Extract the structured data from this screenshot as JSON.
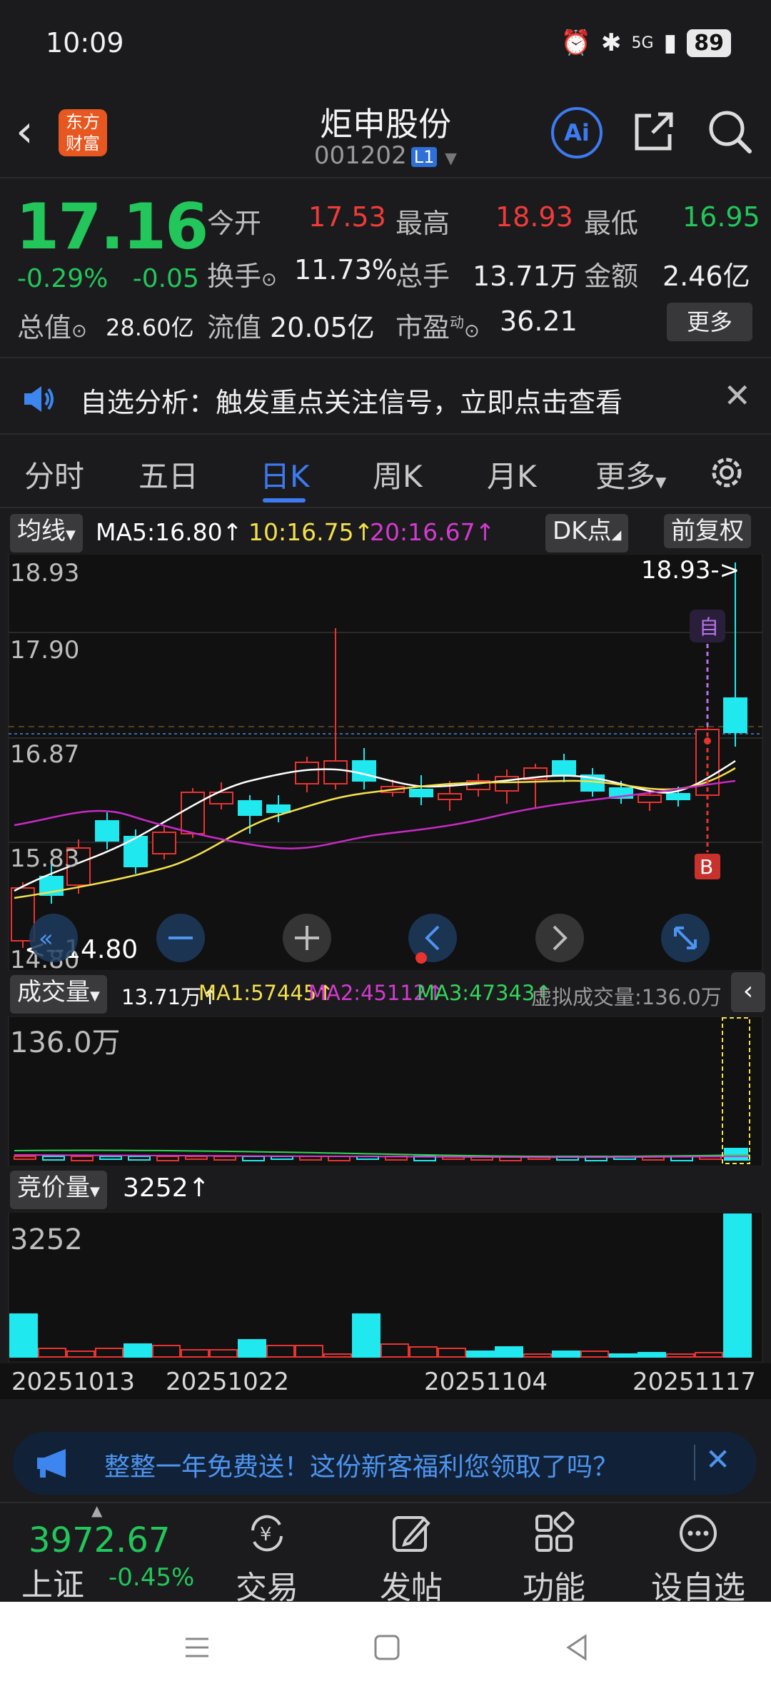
{
  "status": {
    "time": "10:09",
    "network": "5G",
    "battery": "89"
  },
  "header": {
    "title": "炬申股份",
    "code": "001202",
    "level_badge": "L1",
    "logo_line1": "东方",
    "logo_line2": "财富",
    "ai_label": "Ai"
  },
  "quote": {
    "price": "17.16",
    "change_pct": "-0.29%",
    "change_abs": "-0.05",
    "open_label": "今开",
    "open": "17.53",
    "high_label": "最高",
    "high": "18.93",
    "low_label": "最低",
    "low": "16.95",
    "turnover_label": "换手",
    "turnover": "11.73%",
    "volume_label": "总手",
    "volume": "13.71万",
    "amount_label": "金额",
    "amount": "2.46亿",
    "mktcap_label": "总值",
    "mktcap": "28.60亿",
    "float_label": "流值",
    "float": "20.05亿",
    "pe_label": "市盈",
    "pe_super": "动",
    "pe": "36.21",
    "more_label": "更多"
  },
  "notice": {
    "text": "自选分析：触发重点关注信号，立即点击查看"
  },
  "tabs": [
    "分时",
    "五日",
    "日K",
    "周K",
    "月K",
    "更多"
  ],
  "ma_bar": {
    "selector": "均线",
    "ma5": "MA5:16.80↑",
    "ma10": "10:16.75↑",
    "ma20": "20:16.67↑",
    "dk_label": "DK点",
    "adjust_label": "前复权"
  },
  "kline": {
    "price_labels": [
      "18.93",
      "17.90",
      "16.87",
      "15.83",
      "14.80"
    ],
    "high_marker": "18.93->",
    "low_marker": "<--14.80",
    "self_marker": "自",
    "buy_marker": "B",
    "colors": {
      "up": "#e8332f",
      "down": "#1fe8ee",
      "ma5": "#ffffff",
      "ma10": "#f4e04a",
      "ma20": "#c72bc4"
    }
  },
  "volume_bar": {
    "selector": "成交量",
    "vol": "13.71万↑",
    "ma1": "MA1:57445↑",
    "ma2": "MA2:45112↑",
    "ma3": "MA3:47343↑",
    "virtual": "虚拟成交量:136.0万",
    "max_label": "136.0万"
  },
  "auction_bar": {
    "selector": "竞价量",
    "value": "3252↑",
    "max_label": "3252"
  },
  "dates": [
    "20251013",
    "20251022",
    "20251104",
    "20251117"
  ],
  "promo": {
    "text": "整整一年免费送！这份新客福利您领取了吗？"
  },
  "bottom_nav": {
    "index_value": "3972.67",
    "index_name": "上证",
    "index_change": "-0.45%",
    "items": [
      "交易",
      "发帖",
      "功能",
      "设自选"
    ]
  }
}
